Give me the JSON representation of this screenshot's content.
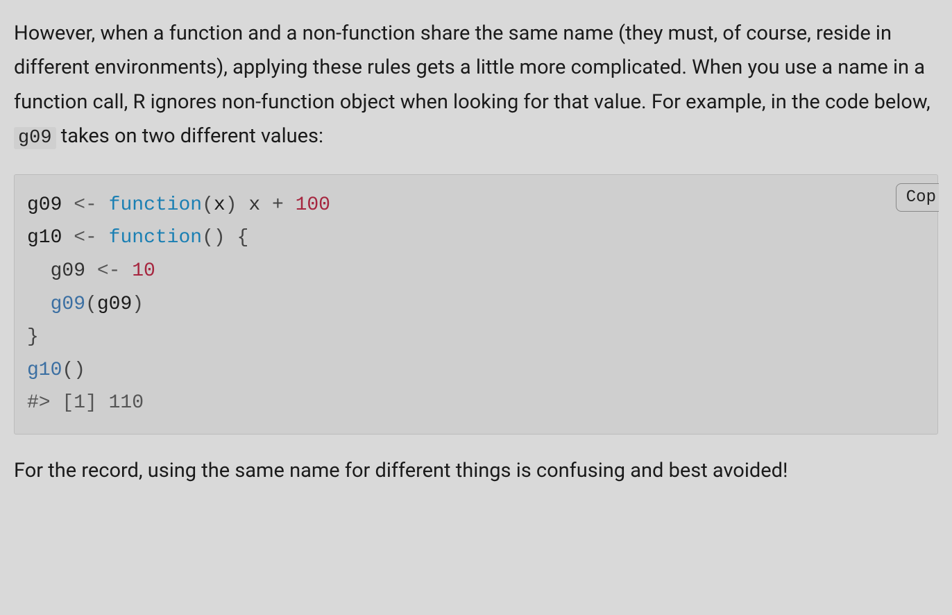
{
  "paragraph1": {
    "pre": "However, when a function and a non-function share the same name (they must, of course, reside in different environments), applying these rules gets a little more complicated. When you use a name in a function call, R ignores non-function object when looking for that value. For example, in the code below, ",
    "inline_code": "g09",
    "post": " takes on two different values:"
  },
  "code": {
    "copy_label": "Cop",
    "tokens": [
      {
        "t": "ident",
        "v": "g09"
      },
      {
        "t": "text",
        "v": " "
      },
      {
        "t": "assign",
        "v": "<-"
      },
      {
        "t": "text",
        "v": " "
      },
      {
        "t": "function",
        "v": "function"
      },
      {
        "t": "punct",
        "v": "("
      },
      {
        "t": "ident",
        "v": "x"
      },
      {
        "t": "punct",
        "v": ")"
      },
      {
        "t": "text",
        "v": " x "
      },
      {
        "t": "punct",
        "v": "+"
      },
      {
        "t": "text",
        "v": " "
      },
      {
        "t": "num",
        "v": "100"
      },
      {
        "t": "nl",
        "v": "\n"
      },
      {
        "t": "ident",
        "v": "g10"
      },
      {
        "t": "text",
        "v": " "
      },
      {
        "t": "assign",
        "v": "<-"
      },
      {
        "t": "text",
        "v": " "
      },
      {
        "t": "function",
        "v": "function"
      },
      {
        "t": "punct",
        "v": "()"
      },
      {
        "t": "text",
        "v": " "
      },
      {
        "t": "punct",
        "v": "{"
      },
      {
        "t": "nl",
        "v": "\n"
      },
      {
        "t": "text",
        "v": "  g09 "
      },
      {
        "t": "assign",
        "v": "<-"
      },
      {
        "t": "text",
        "v": " "
      },
      {
        "t": "num",
        "v": "10"
      },
      {
        "t": "nl",
        "v": "\n"
      },
      {
        "t": "text",
        "v": "  "
      },
      {
        "t": "call",
        "v": "g09"
      },
      {
        "t": "punct",
        "v": "("
      },
      {
        "t": "ident",
        "v": "g09"
      },
      {
        "t": "punct",
        "v": ")"
      },
      {
        "t": "nl",
        "v": "\n"
      },
      {
        "t": "punct",
        "v": "}"
      },
      {
        "t": "nl",
        "v": "\n"
      },
      {
        "t": "call",
        "v": "g10"
      },
      {
        "t": "punct",
        "v": "()"
      },
      {
        "t": "nl",
        "v": "\n"
      },
      {
        "t": "comment",
        "v": "#> [1] 110"
      }
    ]
  },
  "paragraph2": "For the record, using the same name for different things is confusing and best avoided!"
}
